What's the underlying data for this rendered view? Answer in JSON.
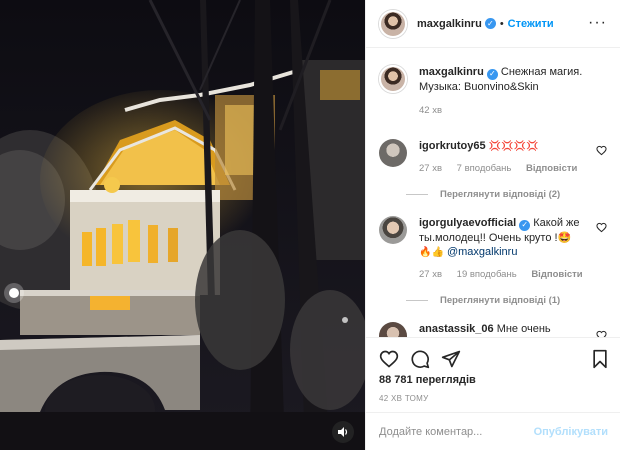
{
  "post": {
    "username": "maxgalkinru",
    "follow_label": "Стежити",
    "more_icon": "more-options-icon",
    "caption_line1": "Снежная магия.",
    "caption_line2": "Музыка: Buonvino&Skin",
    "caption_time": "42 хв"
  },
  "comments": [
    {
      "username": "igorkrutoy65",
      "text": "💢💢💢💢",
      "time": "27 хв",
      "likes": "7 вподобань",
      "reply": "Відповісти",
      "view_replies": "Переглянути відповіді (2)"
    },
    {
      "username": "igorgulyaevofficial",
      "text_line1": "Какой же",
      "text_line2": "ты.молодец!! Очень круто !🤩",
      "emoji": "🔥👍",
      "mention": "@maxgalkinru",
      "time": "27 хв",
      "likes": "19 вподобань",
      "reply": "Відповісти",
      "view_replies": "Переглянути відповіді (1)"
    },
    {
      "username": "anastassik_06",
      "text": "Мне очень"
    }
  ],
  "stats": {
    "views": "88 781 переглядів",
    "posted_ago": "42 ХВ ТОМУ"
  },
  "add_comment": {
    "placeholder": "Додайте коментар...",
    "post_label": "Опублікувати"
  },
  "colors": {
    "accent": "#0095f6",
    "verified": "#3897f0",
    "secondary_text": "#8e8e8e",
    "post_disabled": "#b2dffc"
  }
}
